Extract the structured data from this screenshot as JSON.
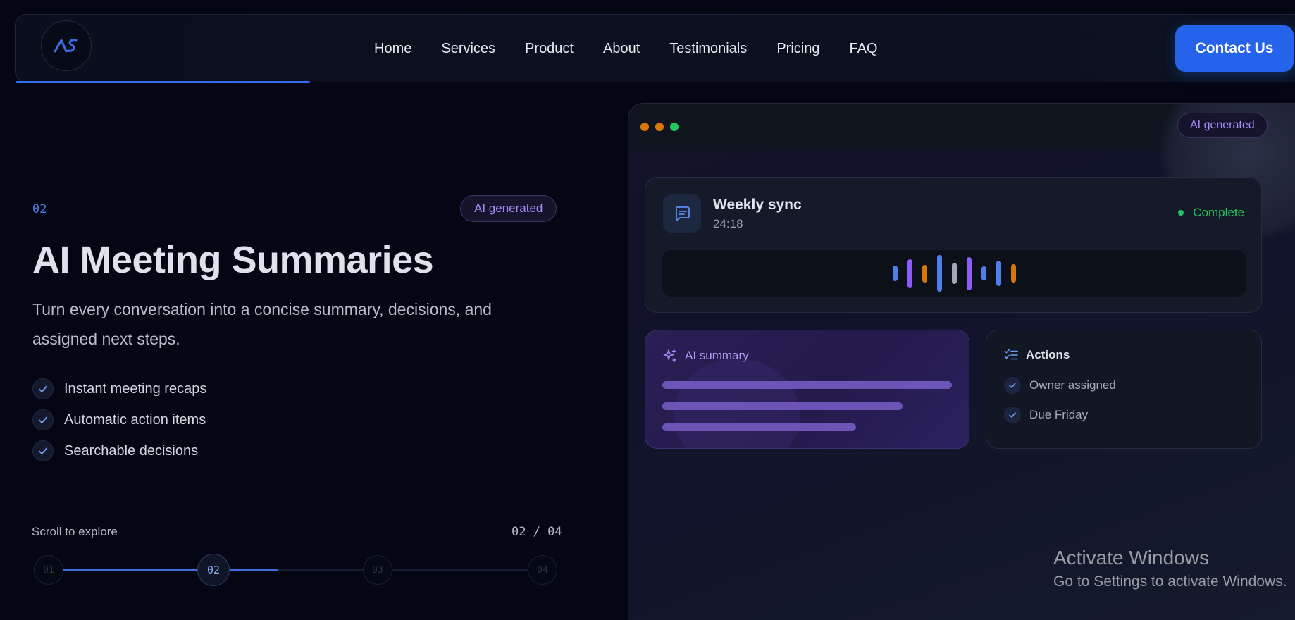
{
  "nav": {
    "logo_text": "AS",
    "links": [
      "Home",
      "Services",
      "Product",
      "About",
      "Testimonials",
      "Pricing",
      "FAQ"
    ],
    "contact_label": "Contact Us",
    "progress_fraction": 0.23
  },
  "hero": {
    "step": "02",
    "badge": "AI generated",
    "title": "AI Meeting Summaries",
    "subtitle": "Turn every conversation into a concise summary, decisions, and assigned next steps.",
    "features": [
      "Instant meeting recaps",
      "Automatic action items",
      "Searchable decisions"
    ]
  },
  "scroller": {
    "label": "Scroll to explore",
    "counter": "02 / 04",
    "steps": [
      "01",
      "02",
      "03",
      "04"
    ],
    "active_index": 1
  },
  "panel": {
    "badge": "AI generated",
    "window_dot_colors": [
      "#d97706",
      "#d97706",
      "#22c55e"
    ],
    "sync": {
      "title": "Weekly sync",
      "duration": "24:18",
      "status": "Complete",
      "status_color": "#22c55e",
      "wave": [
        {
          "level": 0.42,
          "color": "#4f7ee8"
        },
        {
          "level": 0.78,
          "color": "#8b5cf6"
        },
        {
          "level": 0.48,
          "color": "#d97706"
        },
        {
          "level": 1.0,
          "color": "#4f7ee8"
        },
        {
          "level": 0.58,
          "color": "#a3a8b8"
        },
        {
          "level": 0.9,
          "color": "#8b5cf6"
        },
        {
          "level": 0.38,
          "color": "#4f7ee8"
        },
        {
          "level": 0.7,
          "color": "#4f7ee8"
        },
        {
          "level": 0.5,
          "color": "#d97706"
        }
      ]
    },
    "summary": {
      "title": "AI summary",
      "line_fractions": [
        1.0,
        0.83,
        0.67
      ]
    },
    "actions": {
      "title": "Actions",
      "items": [
        "Owner assigned",
        "Due Friday"
      ]
    }
  },
  "watermark": {
    "line1": "Activate Windows",
    "line2": "Go to Settings to activate Windows."
  }
}
